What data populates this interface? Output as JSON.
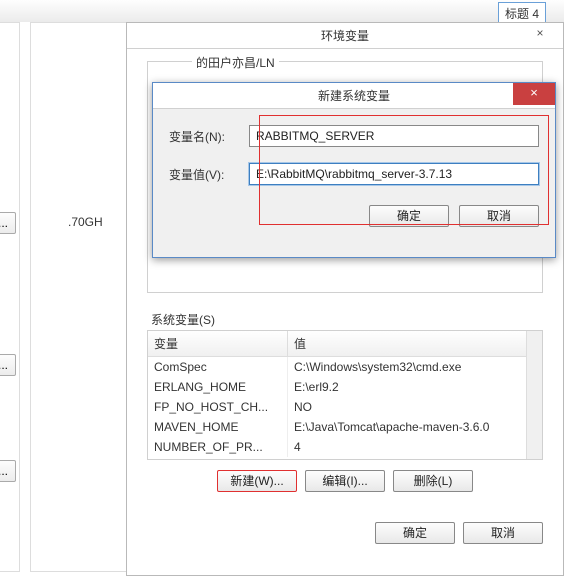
{
  "ribbon": {
    "heading4": "标题 4"
  },
  "bg": {
    "cpu_text": ".70GH",
    "ellipsis": ")..."
  },
  "env_dialog": {
    "title": "环境变量",
    "close": "×",
    "user_legend_partial": "的田户亦昌/LN",
    "sys_label": "系统变量(S)",
    "headers": {
      "var": "变量",
      "val": "值"
    },
    "rows": [
      {
        "var": "ComSpec",
        "val": "C:\\Windows\\system32\\cmd.exe"
      },
      {
        "var": "ERLANG_HOME",
        "val": "E:\\erl9.2"
      },
      {
        "var": "FP_NO_HOST_CH...",
        "val": "NO"
      },
      {
        "var": "MAVEN_HOME",
        "val": "E:\\Java\\Tomcat\\apache-maven-3.6.0"
      },
      {
        "var": "NUMBER_OF_PR...",
        "val": "4"
      }
    ],
    "btn_new": "新建(W)...",
    "btn_edit": "编辑(I)...",
    "btn_delete": "删除(L)",
    "btn_ok": "确定",
    "btn_cancel": "取消"
  },
  "new_dialog": {
    "title": "新建系统变量",
    "close": "×",
    "name_label": "变量名(N):",
    "name_value": "RABBITMQ_SERVER",
    "value_label": "变量值(V):",
    "value_value": "E:\\RabbitMQ\\rabbitmq_server-3.7.13",
    "btn_ok": "确定",
    "btn_cancel": "取消"
  }
}
